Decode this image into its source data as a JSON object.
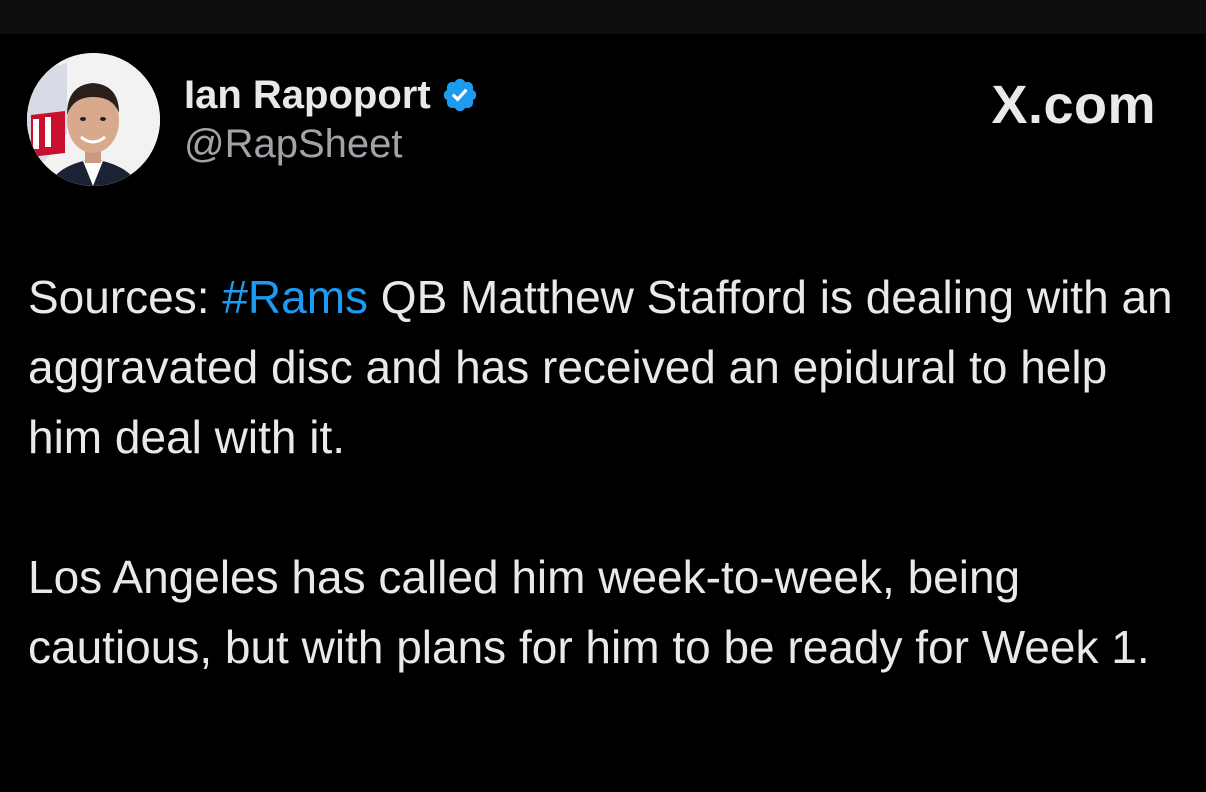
{
  "author": {
    "name": "Ian Rapoport",
    "handle": "@RapSheet",
    "verified": true,
    "avatar_icon": "profile-photo"
  },
  "site": {
    "brand": "X.com"
  },
  "tweet": {
    "paragraph1": {
      "before": "Sources: ",
      "hashtag": "#Rams",
      "after": " QB Matthew Stafford is dealing with an aggravated disc and has received an epidural to help him deal with it."
    },
    "paragraph2": "Los Angeles has called him week-to-week, being cautious, but with plans for him to be ready for Week 1."
  },
  "colors": {
    "background": "#000000",
    "text": "#e7e9ea",
    "secondary_text": "#a0a4a8",
    "accent_link": "#1d9bf0",
    "verified_badge": "#1d9bf0"
  }
}
